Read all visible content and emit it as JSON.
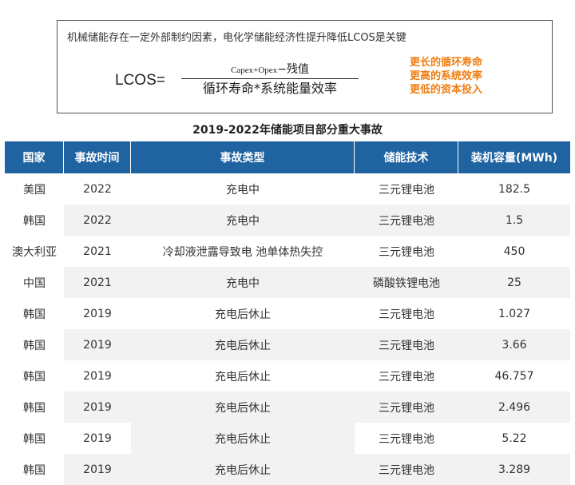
{
  "formula": {
    "headline": "机械储能存在一定外部制约因素，电化学储能经济性提升降低LCOS是关键",
    "lhs": "LCOS=",
    "numerator_capex_opex": "Capex+Opex",
    "numerator_minus": "−",
    "numerator_residual": "残值",
    "denominator": "循环寿命*系统能量效率",
    "levers": [
      "更长的循环寿命",
      "更高的系统效率",
      "更低的资本投入"
    ]
  },
  "table": {
    "title": "2019-2022年储能项目部分重大事故",
    "headers": [
      "国家",
      "事故时间",
      "事故类型",
      "储能技术",
      "装机容量(MWh)"
    ],
    "rows": [
      {
        "country": "美国",
        "year": "2022",
        "type": "充电中",
        "tech": "三元锂电池",
        "capacity": "182.5"
      },
      {
        "country": "韩国",
        "year": "2022",
        "type": "充电中",
        "tech": "三元锂电池",
        "capacity": "1.5"
      },
      {
        "country": "澳大利亚",
        "year": "2021",
        "type": "冷却液泄露导致电  池单体热失控",
        "tech": "三元锂电池",
        "capacity": "450"
      },
      {
        "country": "中国",
        "year": "2021",
        "type": "充电中",
        "tech": "磷酸铁锂电池",
        "capacity": "25"
      },
      {
        "country": "韩国",
        "year": "2019",
        "type": "充电后休止",
        "tech": "三元锂电池",
        "capacity": "1.027"
      },
      {
        "country": "韩国",
        "year": "2019",
        "type": "充电后休止",
        "tech": "三元锂电池",
        "capacity": "3.66"
      },
      {
        "country": "韩国",
        "year": "2019",
        "type": "充电后休止",
        "tech": "三元锂电池",
        "capacity": "46.757"
      },
      {
        "country": "韩国",
        "year": "2019",
        "type": "充电后休止",
        "tech": "三元锂电池",
        "capacity": "2.496"
      },
      {
        "country": "韩国",
        "year": "2019",
        "type": "充电后休止",
        "tech": "三元锂电池",
        "capacity": "5.22"
      },
      {
        "country": "韩国",
        "year": "2019",
        "type": "充电后休止",
        "tech": "三元锂电池",
        "capacity": "3.289"
      }
    ]
  },
  "colors": {
    "header_bg": "#1f63a1",
    "header_text": "#ffffff",
    "lever_text": "#f07d10",
    "alt_row": "#f2f2f2"
  }
}
